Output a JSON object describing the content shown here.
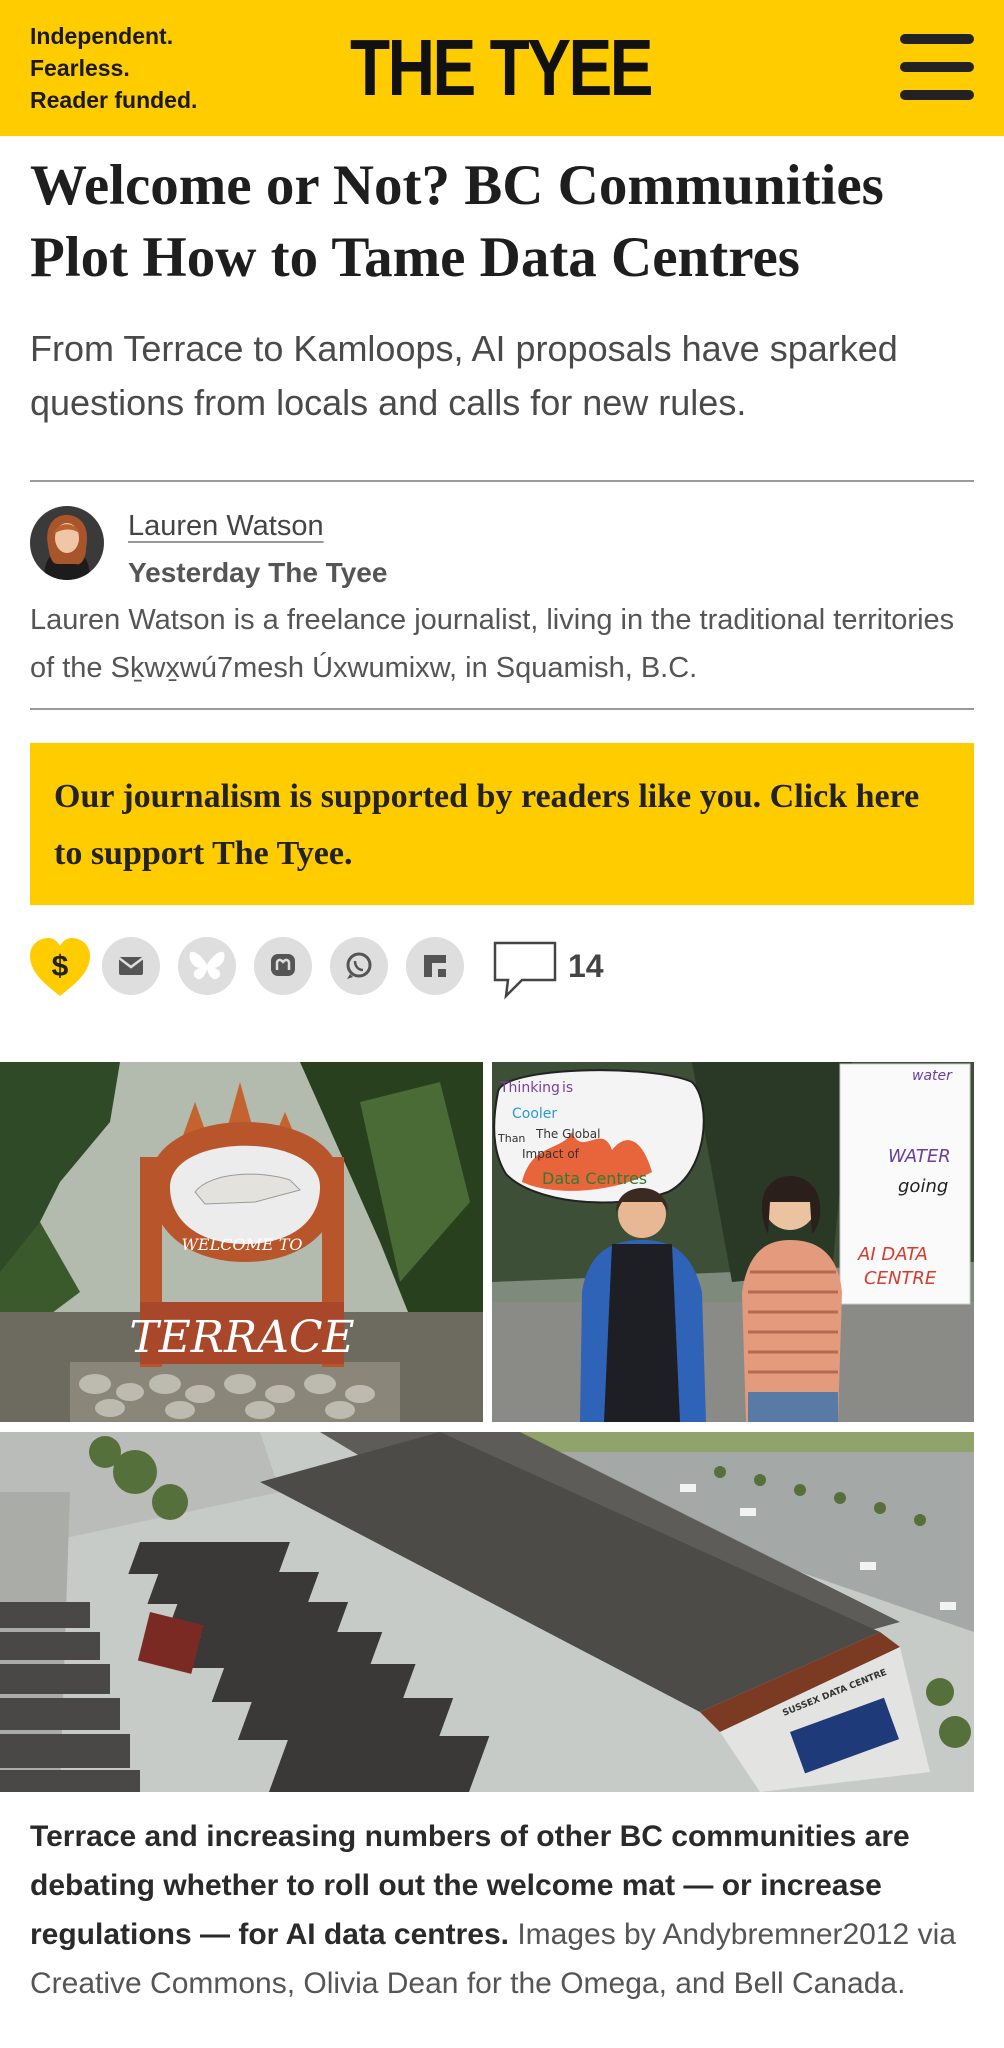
{
  "header": {
    "tagline": [
      "Independent.",
      "Fearless.",
      "Reader funded."
    ],
    "logo": "THE TYEE",
    "menu_icon": "hamburger-menu-icon",
    "background": "#ffcc00"
  },
  "article": {
    "title": "Welcome or Not? BC Communities Plot How to Tame Data Centres",
    "subtitle": "From Terrace to Kamloops, AI proposals have sparked questions from locals and calls for new rules."
  },
  "author": {
    "name": "Lauren Watson",
    "date": "Yesterday",
    "publication": "The Tyee",
    "bio": "Lauren Watson is a freelance journalist, living in the traditional territories of the Sḵwx̱wú7mesh Úxwumixw, in Squamish, B.C."
  },
  "support_banner": {
    "text": "Our journalism is supported by readers like you. Click here to support The Tyee."
  },
  "share": {
    "icons": [
      "heart-dollar-icon",
      "email-icon",
      "bluesky-icon",
      "mastodon-icon",
      "whatsapp-icon",
      "flipboard-icon",
      "comment-icon"
    ],
    "comment_count": "14"
  },
  "images": {
    "terrace_sign": {
      "welcome_text": "WELCOME TO",
      "town_text": "TERRACE"
    },
    "protest": {
      "sign_text": [
        "Thinking",
        "is",
        "Cooler",
        "Than",
        "The Global",
        "Impact of",
        "Data Centres"
      ],
      "poster_text": [
        "water",
        "WATER",
        "going",
        "AI DATA",
        "CENTRE"
      ]
    },
    "rendering": {
      "building_label": "SUSSEX DATA CENTRE"
    }
  },
  "caption": {
    "bold": "Terrace and increasing numbers of other BC communities are debating whether to roll out the welcome mat — or increase regulations — for AI data centres.",
    "credit": " Images by Andybremner2012 via Creative Commons, Olivia Dean for the Omega, and Bell Canada."
  }
}
